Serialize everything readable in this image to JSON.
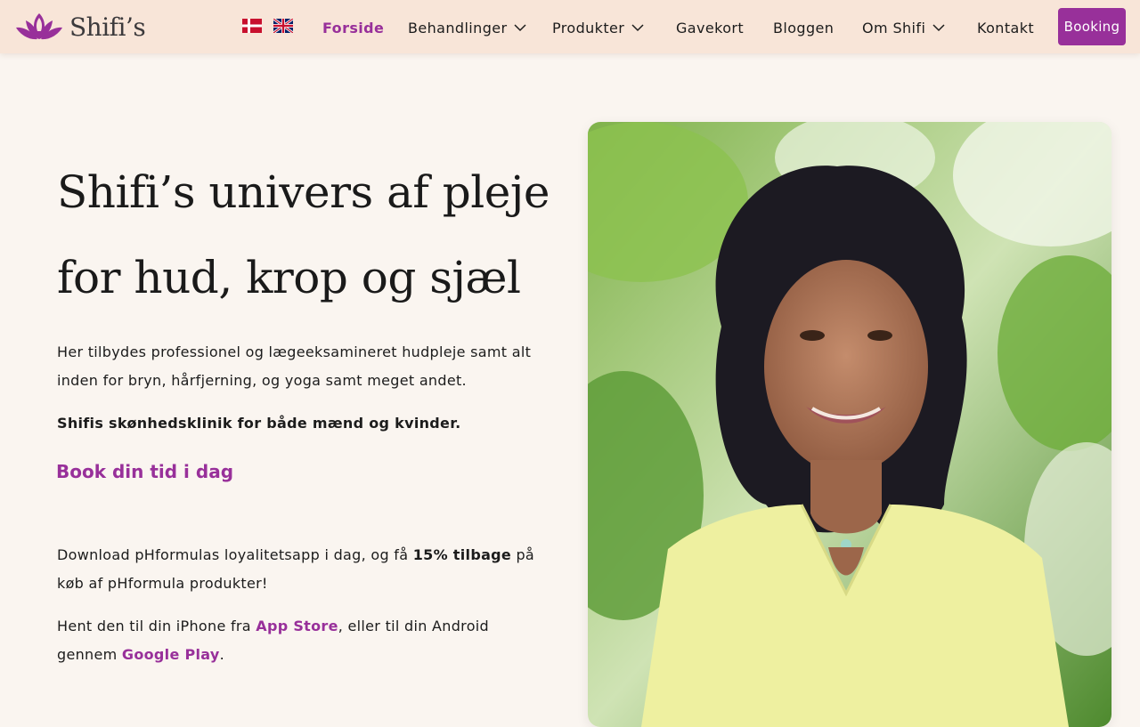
{
  "header": {
    "logo_text": "Shifi’s",
    "languages": [
      {
        "code": "da",
        "icon": "danish-flag-icon"
      },
      {
        "code": "en",
        "icon": "uk-flag-icon"
      }
    ],
    "nav": [
      {
        "label": "Forside",
        "active": true
      },
      {
        "label": "Behandlinger",
        "dropdown": true
      },
      {
        "label": "Produkter",
        "dropdown": true
      },
      {
        "label": "Gavekort"
      },
      {
        "label": "Bloggen"
      },
      {
        "label": "Om Shifi",
        "dropdown": true
      },
      {
        "label": "Kontakt"
      }
    ],
    "booking_label": "Booking"
  },
  "hero": {
    "title_line1": "Shifi’s univers af pleje",
    "title_line2": "for hud, krop og sjæl",
    "intro": "Her tilbydes professionel og lægeeksamineret hudpleje samt alt inden for bryn, hårfjerning, og yoga samt meget andet.",
    "tagline": "Shifis skønhedsklinik for både mænd og kvinder.",
    "cta": "Book din tid i dag",
    "app_text_before": "Download pHformulas loyalitetsapp i dag, og få ",
    "app_text_strong": "15% tilbage",
    "app_text_after": " på køb af pHformula produkter!",
    "store_text_before": "Hent den til din iPhone fra ",
    "app_store_link": "App Store",
    "store_text_middle": ", eller til din Android gennem ",
    "google_play_link": "Google Play",
    "store_text_after": "."
  },
  "colors": {
    "accent": "#98309a",
    "header_bg": "#f8e5d8",
    "page_bg": "#faf5f0",
    "text": "#1c1c1c"
  }
}
